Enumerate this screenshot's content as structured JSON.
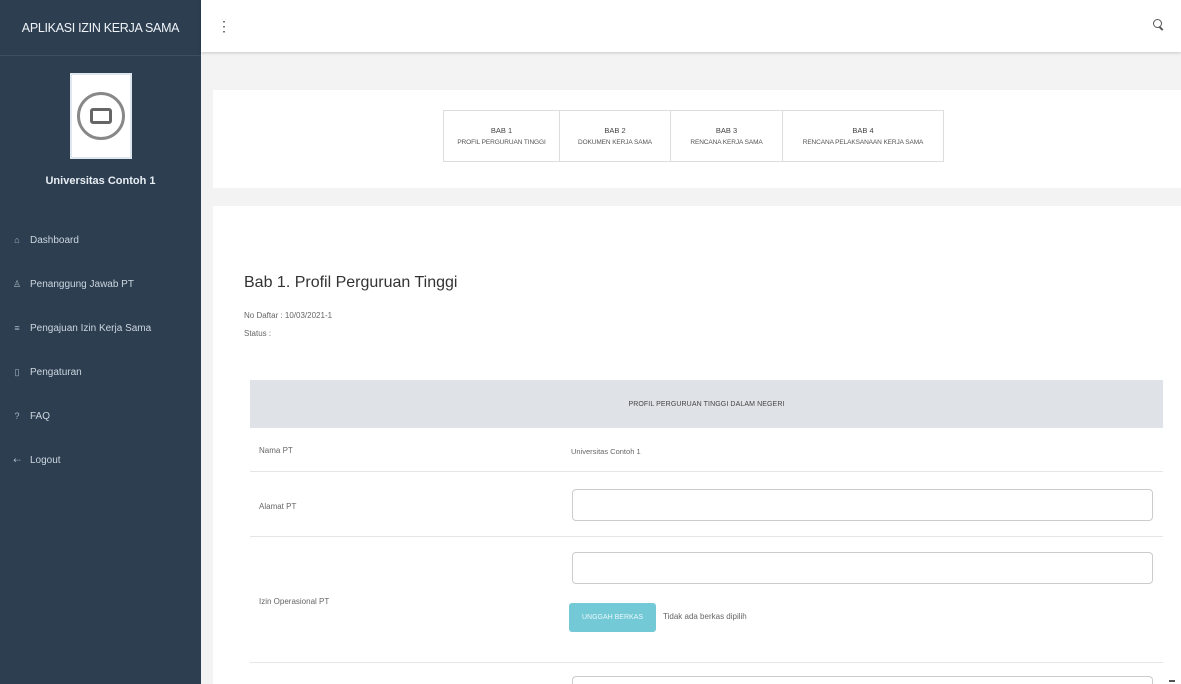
{
  "app": {
    "title": "APLIKASI IZIN KERJA SAMA"
  },
  "sidebar": {
    "university": "Universitas Contoh 1",
    "items": [
      {
        "icon": "dashboard-icon",
        "glyph": "⌂",
        "label": "Dashboard"
      },
      {
        "icon": "user-icon",
        "glyph": "♙",
        "label": "Penanggung Jawab PT"
      },
      {
        "icon": "list-icon",
        "glyph": "≡",
        "label": "Pengajuan Izin Kerja Sama"
      },
      {
        "icon": "file-icon",
        "glyph": "▯",
        "label": "Pengaturan"
      },
      {
        "icon": "help-icon",
        "glyph": "?",
        "label": "FAQ"
      },
      {
        "icon": "logout-icon",
        "glyph": "⇠",
        "label": "Logout"
      }
    ]
  },
  "topbar": {
    "menu_glyph": "⋮"
  },
  "steps": [
    {
      "title": "BAB 1",
      "subtitle": "PROFIL PERGURUAN TINGGI"
    },
    {
      "title": "BAB 2",
      "subtitle": "DOKUMEN KERJA SAMA"
    },
    {
      "title": "BAB 3",
      "subtitle": "RENCANA KERJA SAMA"
    },
    {
      "title": "BAB 4",
      "subtitle": "RENCANA PELAKSANAAN KERJA SAMA"
    }
  ],
  "page": {
    "title": "Bab 1. Profil Perguruan Tinggi",
    "registration": "No Daftar : 10/03/2021-1",
    "status": "Status :"
  },
  "panel": {
    "header": "PROFIL PERGURUAN TINGGI DALAM NEGERI"
  },
  "form": {
    "rows": [
      {
        "label": "Nama PT",
        "value": "Universitas Contoh 1"
      },
      {
        "label": "Alamat PT"
      },
      {
        "label": "Izin Operasional PT"
      }
    ],
    "upload_button": "UNGGAH BERKAS",
    "file_note": "Tidak ada berkas dipilih"
  },
  "colors": {
    "sidebar": "#2c3e50",
    "accent": "#74c9d6",
    "panel_header": "#dfe3e7"
  }
}
